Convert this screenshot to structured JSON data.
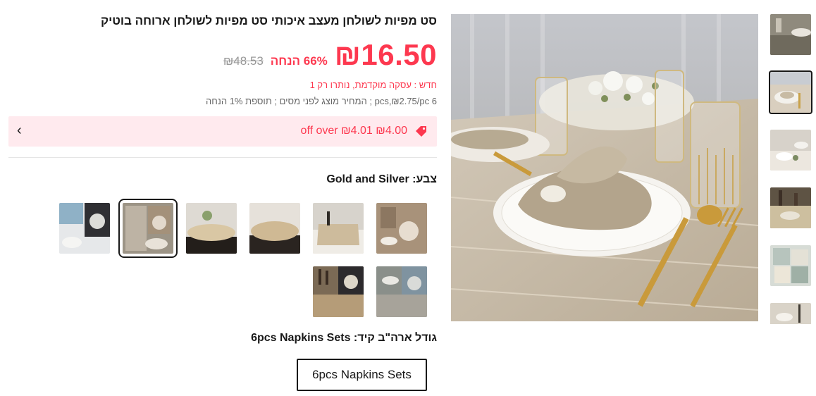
{
  "product": {
    "title": "סט מפיות לשולחן מעצב איכותי סט מפיות לשולחן ארוחה בוטיק",
    "price": "₪16.50",
    "discount": "66% הנחה",
    "original_price": "₪48.53",
    "status_line": "חדש  :  עסקה מוקדמת, נותרו רק 1",
    "info_line": "6 pcs,₪2.75/pc ; המחיר מוצג לפני מסים ; תוספת 1% הנחה"
  },
  "coupon": {
    "text": "₪4.00 ₪4.01 off over",
    "icon": "tag-icon",
    "arrow": "‹"
  },
  "color": {
    "label": "צבע: Gold and Silver",
    "selected_index": 4,
    "options_count": 8
  },
  "size": {
    "label": "גודל ארה\"ב קיד: 6pcs Napkins Sets",
    "option": "6pcs Napkins Sets"
  },
  "colors": {
    "accent": "#fd384f",
    "coupon_bg": "#ffeaee",
    "text": "#191919"
  }
}
